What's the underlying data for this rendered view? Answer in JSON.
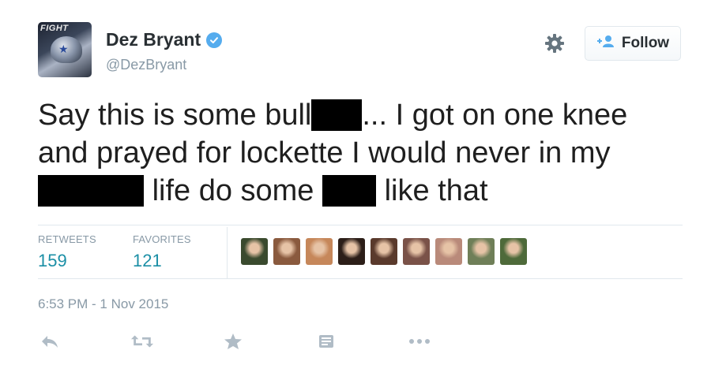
{
  "header": {
    "avatar_text": "FIGHT",
    "display_name": "Dez Bryant",
    "handle": "@DezBryant",
    "follow_label": "Follow"
  },
  "tweet": {
    "line1_a": "Say this is some bull",
    "line1_b": "... I got on one knee",
    "line2": "and prayed for lockette I would never in my",
    "line3_a": "life do some",
    "line3_b": "like that"
  },
  "stats": {
    "retweets_label": "RETWEETS",
    "retweets_count": "159",
    "favorites_label": "FAVORITES",
    "favorites_count": "121"
  },
  "favoriters": [
    {
      "color": "#3a4a2e"
    },
    {
      "color": "#8a5a3e"
    },
    {
      "color": "#c6875a"
    },
    {
      "color": "#2c1e18"
    },
    {
      "color": "#5a3a2c"
    },
    {
      "color": "#7a5248"
    },
    {
      "color": "#b98a7a"
    },
    {
      "color": "#6f7f58"
    },
    {
      "color": "#4e6a3a"
    }
  ],
  "timestamp": "6:53 PM - 1 Nov 2015",
  "colors": {
    "verified": "#55acee",
    "count": "#1b8fa6",
    "muted": "#8899a6",
    "icon": "#b0bcc6"
  },
  "icons": [
    "gear-icon",
    "follow-person-icon",
    "verified-badge-icon",
    "reply-icon",
    "retweet-icon",
    "favorite-icon",
    "summary-icon",
    "more-icon"
  ]
}
